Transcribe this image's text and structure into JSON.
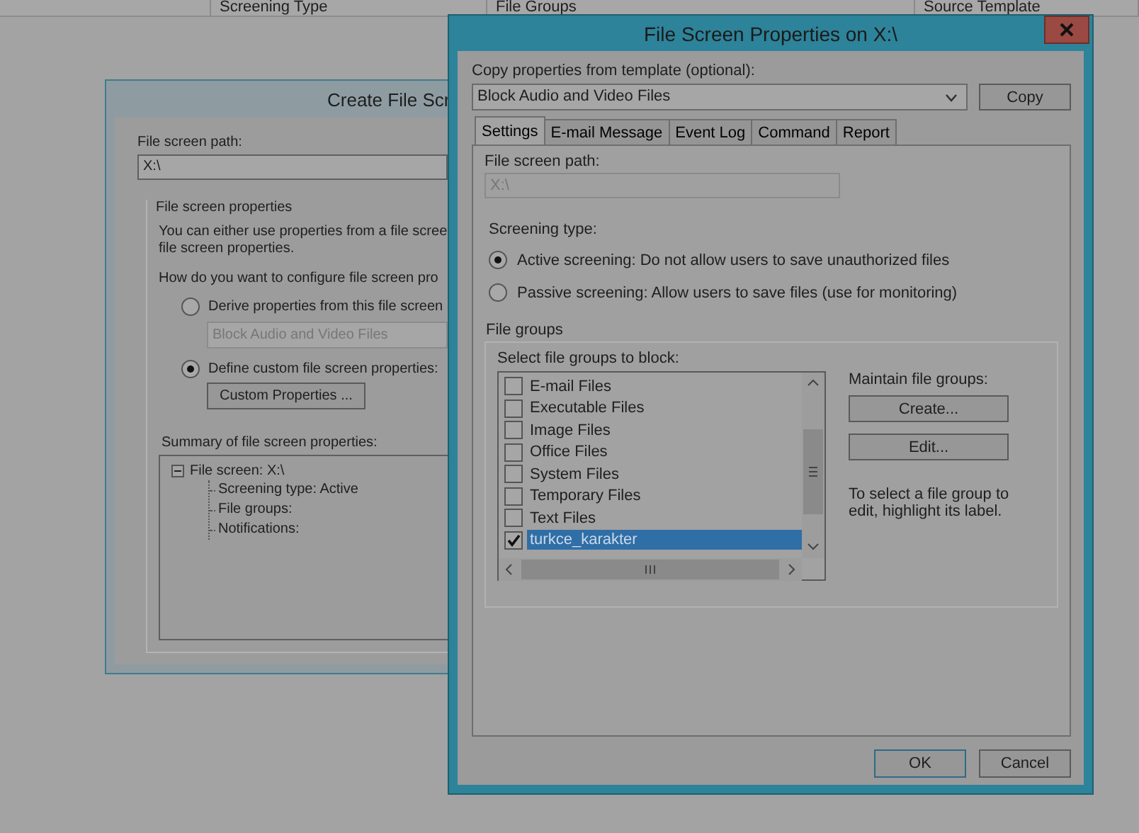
{
  "background_table": {
    "columns": [
      "Screening Type",
      "File Groups",
      "Source Template"
    ]
  },
  "create_dialog": {
    "title": "Create File Scr",
    "path_label": "File screen path:",
    "path_value": "X:\\",
    "properties_group": {
      "title": "File screen properties",
      "description": [
        "You can either use properties from a file scree",
        "file screen properties."
      ],
      "question": "How do you want to configure file screen pro",
      "options": [
        {
          "kind": "template",
          "label": "Derive properties from this file screen",
          "selected": false,
          "template": "Block Audio and Video Files"
        },
        {
          "kind": "custom",
          "label": "Define custom file screen properties:",
          "selected": true,
          "button": "Custom Properties ..."
        }
      ],
      "summary_label": "Summary of file screen properties:",
      "summary_tree": [
        {
          "label": "File screen: X:\\",
          "expanded": true,
          "children": [
            {
              "label": "Screening type: Active"
            },
            {
              "label": "File groups:"
            },
            {
              "label": "Notifications:"
            }
          ]
        }
      ]
    }
  },
  "properties_dialog": {
    "title": "File Screen Properties on X:\\",
    "template_label": "Copy properties from template (optional):",
    "template_value": "Block Audio and Video Files",
    "copy_button": "Copy",
    "tabs": [
      {
        "label": "Settings",
        "selected": true
      },
      {
        "label": "E-mail Message",
        "selected": false
      },
      {
        "label": "Event Log",
        "selected": false
      },
      {
        "label": "Command",
        "selected": false
      },
      {
        "label": "Report",
        "selected": false
      }
    ],
    "path_label": "File screen path:",
    "path_value": "X:\\",
    "screening_label": "Screening type:",
    "screening_options": [
      {
        "label": "Active screening: Do not allow users to save unauthorized files",
        "selected": true
      },
      {
        "label": "Passive screening: Allow users to save files (use for monitoring)",
        "selected": false
      }
    ],
    "file_groups": {
      "title": "File groups",
      "list_label": "Select file groups to block:",
      "items": [
        {
          "label": "E-mail Files",
          "checked": false,
          "selected": false
        },
        {
          "label": "Executable Files",
          "checked": false,
          "selected": false
        },
        {
          "label": "Image Files",
          "checked": false,
          "selected": false
        },
        {
          "label": "Office Files",
          "checked": false,
          "selected": false
        },
        {
          "label": "System Files",
          "checked": false,
          "selected": false
        },
        {
          "label": "Temporary Files",
          "checked": false,
          "selected": false
        },
        {
          "label": "Text Files",
          "checked": false,
          "selected": false
        },
        {
          "label": "turkce_karakter",
          "checked": true,
          "selected": true
        }
      ],
      "maintain_label": "Maintain file groups:",
      "buttons": [
        "Create...",
        "Edit..."
      ],
      "hint": "To select a file group to edit, highlight its label."
    },
    "buttons": [
      "OK",
      "Cancel"
    ]
  }
}
